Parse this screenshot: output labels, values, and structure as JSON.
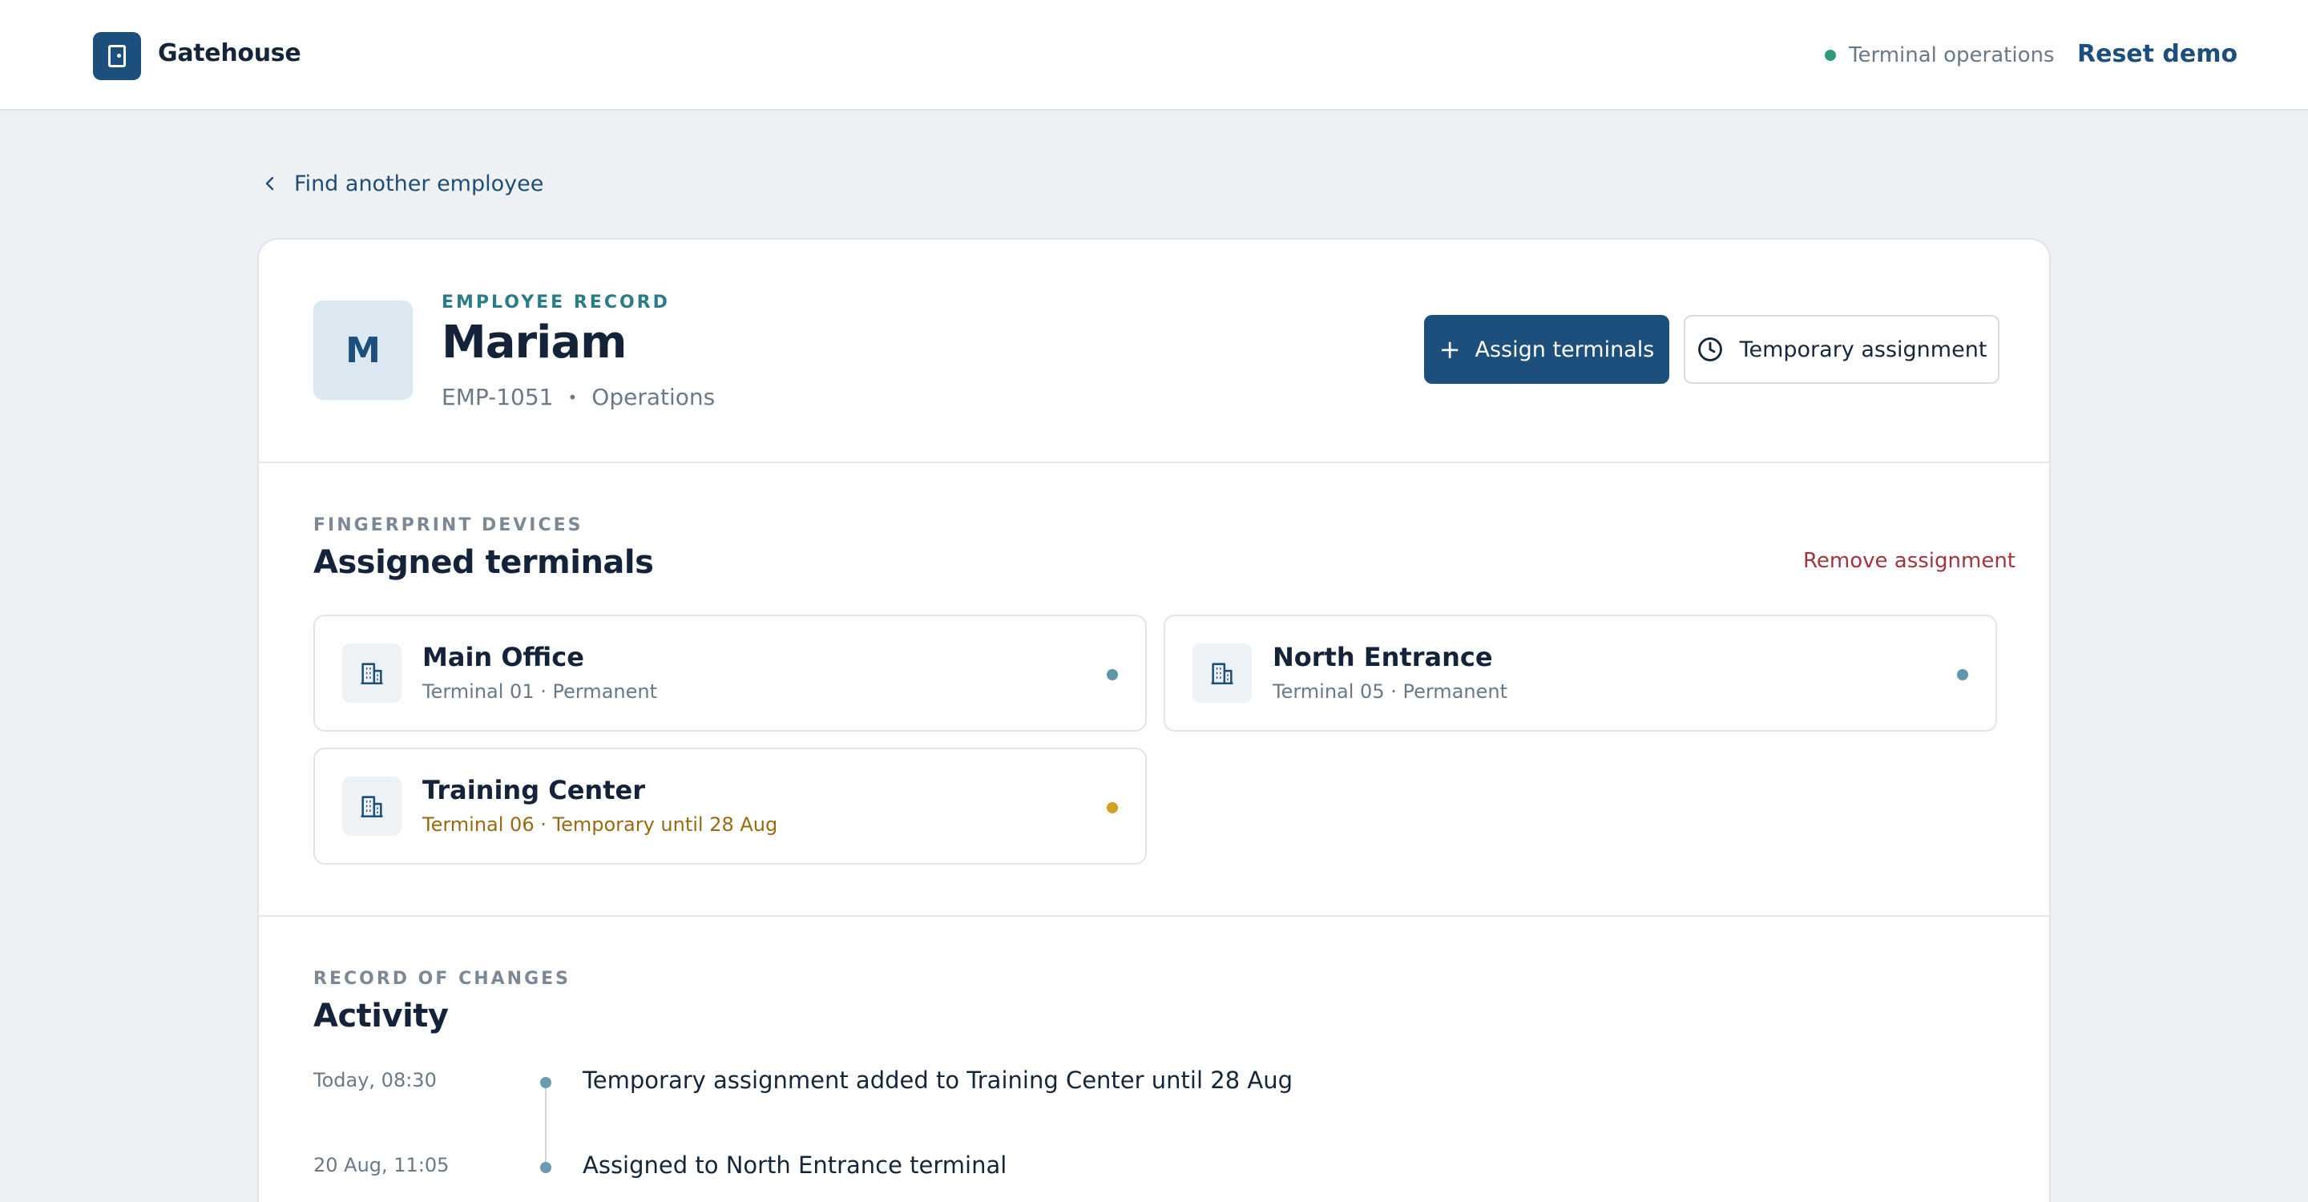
{
  "header": {
    "brand": "Gatehouse",
    "status": "Terminal operations",
    "reset_label": "Reset demo",
    "status_color": "#2f9a7a",
    "brand_color": "#1d4f7c"
  },
  "nav": {
    "back_label": "Find another employee"
  },
  "employee": {
    "eyebrow": "EMPLOYEE RECORD",
    "initial": "M",
    "name": "Mariam",
    "id": "EMP-1051",
    "separator": "•",
    "department": "Operations"
  },
  "actions": {
    "assign_label": "Assign terminals",
    "temporary_label": "Temporary assignment"
  },
  "terminals": {
    "eyebrow": "FINGERPRINT DEVICES",
    "title": "Assigned terminals",
    "remove_label": "Remove assignment",
    "items": [
      {
        "name": "Main Office",
        "detail": "Terminal 01 · Permanent",
        "status": "permanent",
        "dot_color": "#5f97a8",
        "icon": "building-icon"
      },
      {
        "name": "North Entrance",
        "detail": "Terminal 05 · Permanent",
        "status": "permanent",
        "dot_color": "#5f97a8",
        "icon": "building-icon"
      },
      {
        "name": "Training Center",
        "detail": "Terminal 06 · Temporary until 28 Aug",
        "status": "temporary",
        "dot_color": "#d4a020",
        "icon": "building-icon"
      }
    ]
  },
  "activity": {
    "eyebrow": "RECORD OF CHANGES",
    "title": "Activity",
    "items": [
      {
        "time": "Today, 08:30",
        "text": "Temporary assignment added to Training Center until 28 Aug"
      },
      {
        "time": "20 Aug, 11:05",
        "text": "Assigned to North Entrance terminal"
      }
    ]
  }
}
